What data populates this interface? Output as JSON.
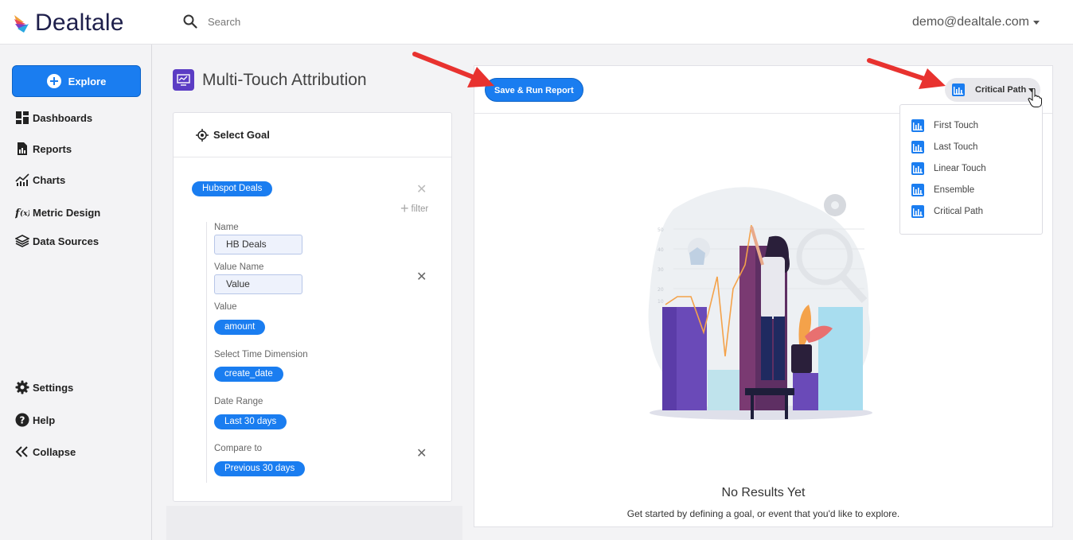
{
  "app": {
    "name": "Dealtale"
  },
  "header": {
    "search_placeholder": "Search",
    "user": "demo@dealtale.com"
  },
  "sidebar": {
    "explore_label": "Explore",
    "items": [
      {
        "label": "Dashboards",
        "icon": "dashboard-icon"
      },
      {
        "label": "Reports",
        "icon": "report-icon"
      },
      {
        "label": "Charts",
        "icon": "charts-icon"
      },
      {
        "label": "Metric Design",
        "icon": "function-icon"
      },
      {
        "label": "Data Sources",
        "icon": "layers-icon"
      }
    ],
    "bottom_items": [
      {
        "label": "Settings",
        "icon": "gear-icon"
      },
      {
        "label": "Help",
        "icon": "help-icon"
      },
      {
        "label": "Collapse",
        "icon": "double-chevron-left-icon"
      }
    ]
  },
  "page": {
    "title": "Multi-Touch Attribution"
  },
  "goal_panel": {
    "heading": "Select Goal",
    "goal": "Hubspot Deals",
    "filter_label": "filter",
    "fields": {
      "name_label": "Name",
      "name_value": "HB Deals",
      "value_name_label": "Value Name",
      "value_name_value": "Value",
      "value_label": "Value",
      "value_pill": "amount",
      "time_dimension_label": "Select Time Dimension",
      "time_dimension_pill": "create_date",
      "date_range_label": "Date Range",
      "date_range_pill": "Last 30 days",
      "compare_label": "Compare to",
      "compare_pill": "Previous 30 days"
    }
  },
  "results": {
    "run_label": "Save & Run Report",
    "model_selected": "Critical Path",
    "model_options": [
      "First Touch",
      "Last Touch",
      "Linear Touch",
      "Ensemble",
      "Critical Path"
    ],
    "empty_title": "No Results Yet",
    "empty_subtitle": "Get started by defining a goal, or event that you'd like to explore."
  },
  "colors": {
    "accent": "#1a7df0",
    "brand_dark": "#1e1f4b",
    "title_icon": "#5b3cc4",
    "annotation_arrow": "#e8322f"
  }
}
